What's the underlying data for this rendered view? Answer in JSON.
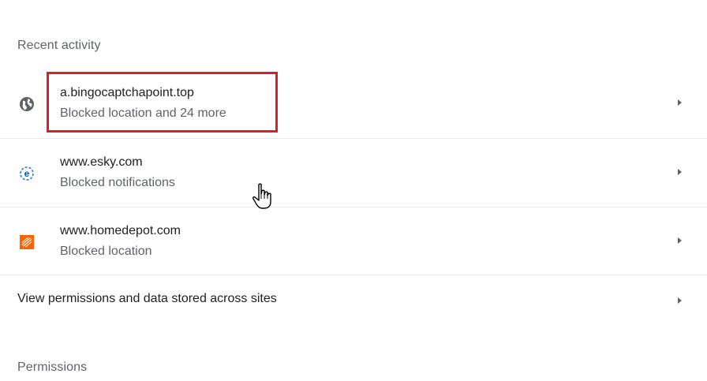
{
  "recent_activity": {
    "title": "Recent activity",
    "sites": [
      {
        "name": "a.bingocaptchapoint.top",
        "detail": "Blocked location and 24 more",
        "icon": "globe-icon"
      },
      {
        "name": "www.esky.com",
        "detail": "Blocked notifications",
        "icon": "esky-favicon-icon"
      },
      {
        "name": "www.homedepot.com",
        "detail": "Blocked location",
        "icon": "homedepot-favicon-icon"
      }
    ]
  },
  "view_all": {
    "label": "View permissions and data stored across sites"
  },
  "permissions": {
    "title": "Permissions"
  },
  "colors": {
    "highlight": "#d9202a",
    "homedepot_orange": "#f96302",
    "esky_blue": "#1a73e8"
  }
}
